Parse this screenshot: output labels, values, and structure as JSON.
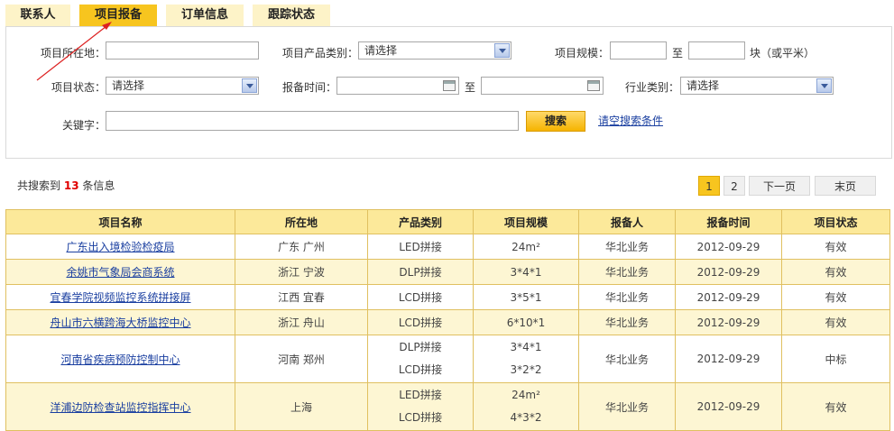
{
  "tabs": [
    {
      "label": "联系人",
      "active": false
    },
    {
      "label": "项目报备",
      "active": true
    },
    {
      "label": "订单信息",
      "active": false
    },
    {
      "label": "跟踪状态",
      "active": false
    }
  ],
  "search": {
    "location_label": "项目所在地：",
    "category_label": "项目产品类别：",
    "category_value": "请选择",
    "scale_label": "项目规模：",
    "scale_to": "至",
    "scale_unit": "块（或平米）",
    "status_label": "项目状态：",
    "status_value": "请选择",
    "time_label": "报备时间：",
    "time_to": "至",
    "industry_label": "行业类别：",
    "industry_value": "请选择",
    "keyword_label": "关键字：",
    "search_button": "搜索",
    "clear_link": "请空搜索条件"
  },
  "result": {
    "prefix": "共搜索到",
    "count": "13",
    "suffix": "条信息"
  },
  "pager": {
    "pages": [
      "1",
      "2"
    ],
    "next": "下一页",
    "last": "末页"
  },
  "table": {
    "headers": [
      "项目名称",
      "所在地",
      "产品类别",
      "项目规模",
      "报备人",
      "报备时间",
      "项目状态"
    ],
    "rows": [
      {
        "name": "广东出入境检验检疫局",
        "location": "广东 广州",
        "category": [
          "LED拼接"
        ],
        "scale": [
          "24m²"
        ],
        "reporter": "华北业务",
        "date": "2012-09-29",
        "status": "有效"
      },
      {
        "name": "余姚市气象局会商系统",
        "location": "浙江 宁波",
        "category": [
          "DLP拼接"
        ],
        "scale": [
          "3*4*1"
        ],
        "reporter": "华北业务",
        "date": "2012-09-29",
        "status": "有效"
      },
      {
        "name": "宜春学院视频监控系统拼接屏",
        "location": "江西 宜春",
        "category": [
          "LCD拼接"
        ],
        "scale": [
          "3*5*1"
        ],
        "reporter": "华北业务",
        "date": "2012-09-29",
        "status": "有效"
      },
      {
        "name": "舟山市六横跨海大桥监控中心",
        "location": "浙江 舟山",
        "category": [
          "LCD拼接"
        ],
        "scale": [
          "6*10*1"
        ],
        "reporter": "华北业务",
        "date": "2012-09-29",
        "status": "有效"
      },
      {
        "name": "河南省疾病预防控制中心",
        "location": "河南 郑州",
        "category": [
          "DLP拼接",
          "LCD拼接"
        ],
        "scale": [
          "3*4*1",
          "3*2*2"
        ],
        "reporter": "华北业务",
        "date": "2012-09-29",
        "status": "中标"
      },
      {
        "name": "洋浦边防检查站监控指挥中心",
        "location": "上海",
        "category": [
          "LED拼接",
          "LCD拼接"
        ],
        "scale": [
          "24m²",
          "4*3*2"
        ],
        "reporter": "华北业务",
        "date": "2012-09-29",
        "status": "有效"
      }
    ]
  }
}
